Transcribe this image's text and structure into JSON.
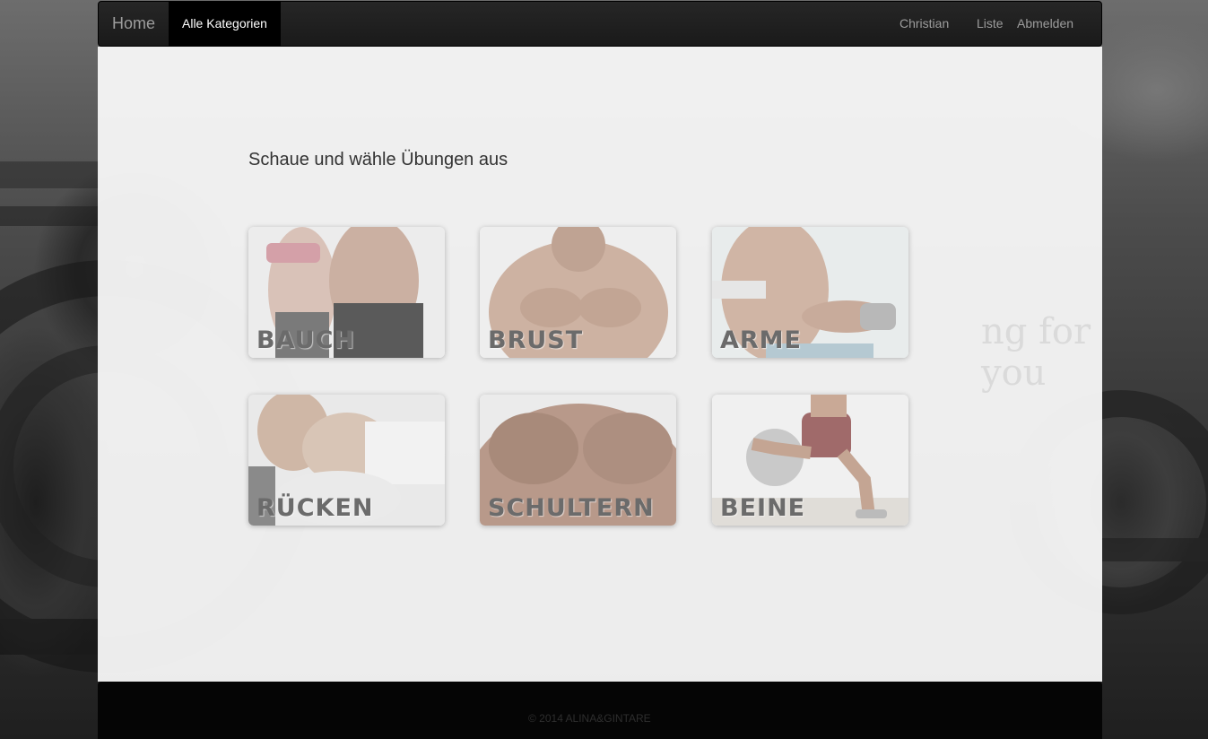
{
  "navbar": {
    "brand": "Home",
    "active_item": "Alle Kategorien",
    "right_items": {
      "user": "Christian",
      "list": "Liste",
      "logout": "Abmelden"
    }
  },
  "main": {
    "heading": "Schaue und wähle Übungen aus",
    "categories": [
      {
        "label": "BAUCH",
        "icon": "abs-photo"
      },
      {
        "label": "BRUST",
        "icon": "chest-photo"
      },
      {
        "label": "ARME",
        "icon": "arms-photo"
      },
      {
        "label": "RÜCKEN",
        "icon": "back-photo"
      },
      {
        "label": "SCHULTERN",
        "icon": "shoulders-photo"
      },
      {
        "label": "BEINE",
        "icon": "legs-photo"
      }
    ]
  },
  "footer": {
    "copyright": "© 2014 ALINA&GINTARE"
  },
  "colors": {
    "navbar": "#1a1a1a",
    "active_nav": "#000000",
    "panel": "#f8f8f8",
    "footer": "#050505"
  }
}
